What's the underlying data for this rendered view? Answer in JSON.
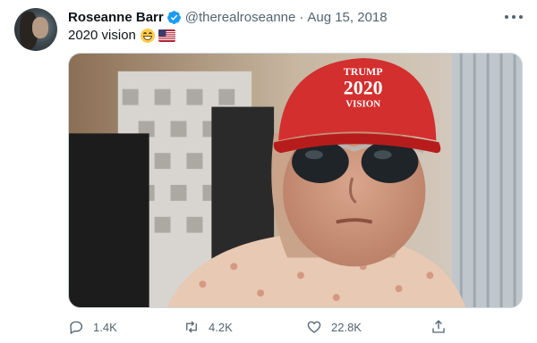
{
  "tweet": {
    "author_name": "Roseanne Barr",
    "handle": "@therealroseanne",
    "separator": "·",
    "date": "Aug 15, 2018",
    "text": "2020 vision",
    "emojis": [
      "grinning-face-emoji",
      "us-flag-emoji"
    ],
    "media": {
      "cap_text_line1": "TRUMP",
      "cap_text_line2": "2020",
      "cap_text_line3": "VISION",
      "colors": {
        "cap": "#d32f2f",
        "background": "#c9b9a8"
      }
    },
    "actions": {
      "reply_count": "1.4K",
      "retweet_count": "4.2K",
      "like_count": "22.8K"
    }
  },
  "colors": {
    "verified": "#1d9bf0",
    "secondary_text": "#536471",
    "primary_text": "#0f1419"
  }
}
